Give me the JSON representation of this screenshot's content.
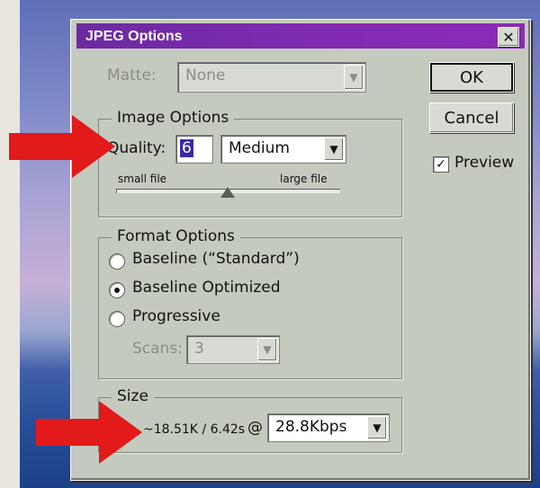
{
  "dialog": {
    "title": "JPEG Options",
    "close_glyph": "✕",
    "matte": {
      "label": "Matte:",
      "value": "None",
      "enabled": false
    },
    "buttons": {
      "ok": "OK",
      "cancel": "Cancel"
    },
    "preview": {
      "label": "Preview",
      "checked": true,
      "check_glyph": "✓"
    },
    "image_options": {
      "title": "Image Options",
      "quality_label": "Quality:",
      "quality_value": "6",
      "quality_preset": "Medium",
      "slider_left": "small file",
      "slider_right": "large file",
      "slider_fraction": 0.5
    },
    "format_options": {
      "title": "Format Options",
      "options": [
        "Baseline (“Standard”)",
        "Baseline Optimized",
        "Progressive"
      ],
      "selected_index": 1,
      "scans_label": "Scans:",
      "scans_value": "3",
      "scans_enabled": false
    },
    "size": {
      "title": "Size",
      "estimate": "~18.51K / 6.42s",
      "at_symbol": "@",
      "modem": "28.8Kbps"
    }
  },
  "icons": {
    "dropdown": "▼",
    "arrow_color": "#e21a1a"
  }
}
